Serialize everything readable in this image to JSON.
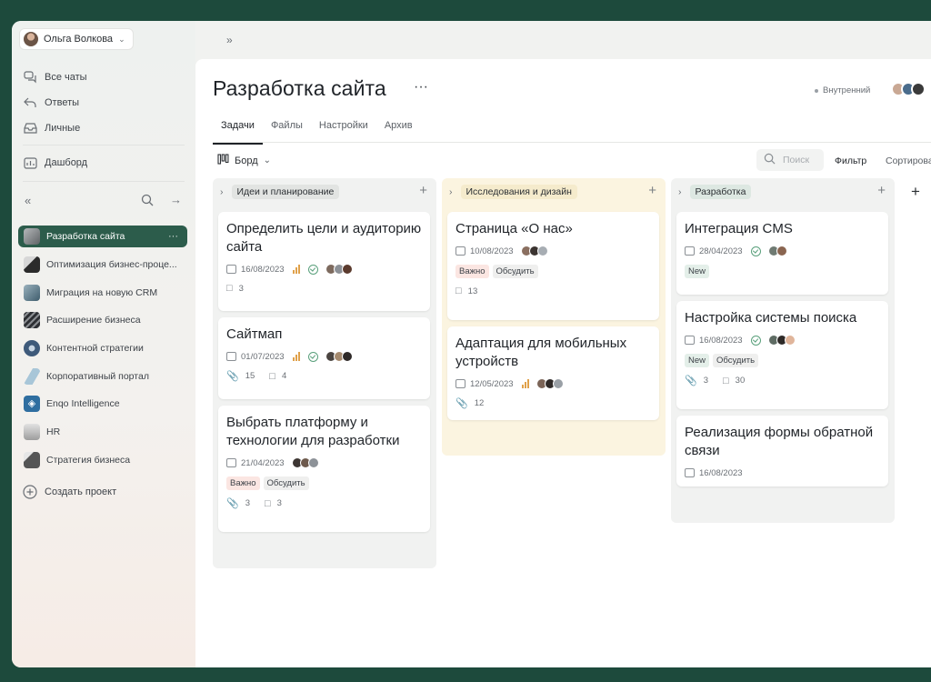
{
  "user": {
    "name": "Ольга Волкова"
  },
  "nav": [
    {
      "label": "Все чаты",
      "icon": "chats-icon"
    },
    {
      "label": "Ответы",
      "icon": "reply-icon"
    },
    {
      "label": "Личные",
      "icon": "inbox-icon"
    },
    {
      "label": "Дашборд",
      "icon": "dashboard-icon"
    }
  ],
  "projects": [
    {
      "label": "Разработка сайта",
      "active": true,
      "color": "#8a8d8f"
    },
    {
      "label": "Оптимизация бизнес-проце...",
      "color": "#4a4a4a"
    },
    {
      "label": "Миграция на новую CRM",
      "color": "#5d7c8c"
    },
    {
      "label": "Расширение бизнеса",
      "color": "#2d2f33"
    },
    {
      "label": "Контентной стратегии",
      "color": "#3e5a7a"
    },
    {
      "label": "Корпоративный портал",
      "color": "#a8c6d8"
    },
    {
      "label": "Enqo Intelligence",
      "color": "#2f6ea0"
    },
    {
      "label": "HR",
      "color": "#c9c9c9"
    },
    {
      "label": "Стратегия бизнеса",
      "color": "#555555"
    }
  ],
  "create_project": "Создать проект",
  "header": {
    "title": "Разработка сайта",
    "visibility": "Внутренний",
    "tabs": [
      "Задачи",
      "Файлы",
      "Настройки",
      "Архив"
    ],
    "view": "Борд",
    "search_placeholder": "Поиск",
    "filter": "Фильтр",
    "sort": "Сортирова"
  },
  "columns": [
    {
      "title": "Идеи и планирование",
      "cards": [
        {
          "title": "Определить цели и аудиторию сайта",
          "date": "16/08/2023",
          "comments": "3"
        },
        {
          "title": "Сайтмап",
          "date": "01/07/2023",
          "attachments": "15",
          "comments": "4"
        },
        {
          "title": "Выбрать платформу и технологии для разработки",
          "date": "21/04/2023",
          "tags": [
            "Важно",
            "Обсудить"
          ],
          "attachments": "3",
          "comments": "3"
        }
      ]
    },
    {
      "title": "Исследования и дизайн",
      "cards": [
        {
          "title": "Страница «О нас»",
          "date": "10/08/2023",
          "tags": [
            "Важно",
            "Обсудить"
          ],
          "comments": "13"
        },
        {
          "title": "Адаптация для мобильных устройств",
          "date": "12/05/2023",
          "attachments": "12"
        }
      ]
    },
    {
      "title": "Разработка",
      "cards": [
        {
          "title": "Интеграция CMS",
          "date": "28/04/2023",
          "tags": [
            "New"
          ]
        },
        {
          "title": "Настройка системы поиска",
          "date": "16/08/2023",
          "tags": [
            "New",
            "Обсудить"
          ],
          "attachments": "3",
          "comments": "30"
        },
        {
          "title": "Реализация формы обратной связи",
          "date": "16/08/2023"
        }
      ]
    }
  ],
  "colors": {
    "accent": "#2c5c4b",
    "background": "#1d4a3c",
    "important_tag": "#fbe6e2",
    "new_tag": "#e4efe9"
  }
}
